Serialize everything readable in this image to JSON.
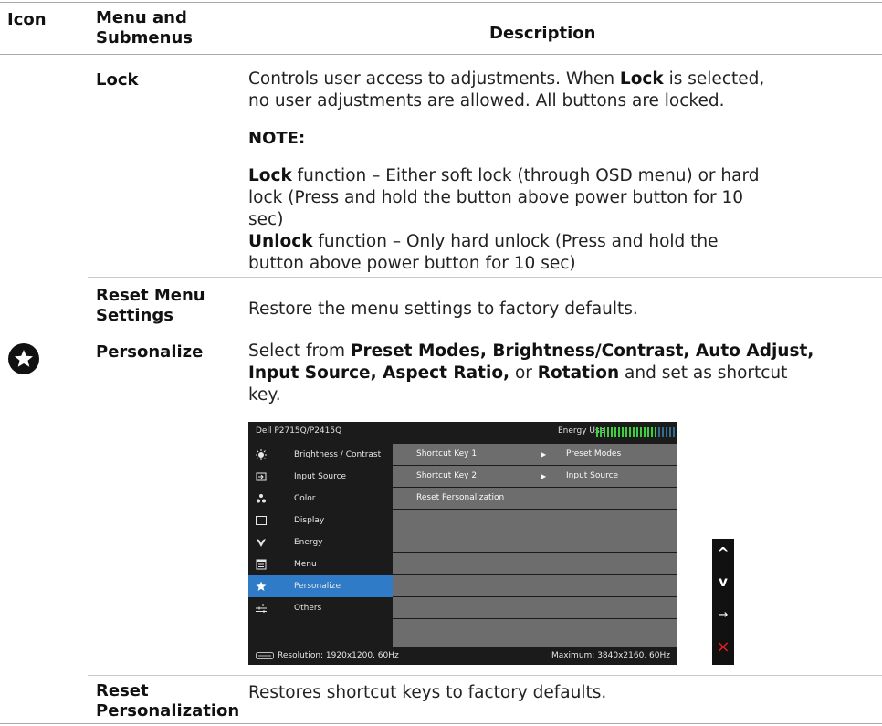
{
  "header": {
    "icon": "Icon",
    "menu_line1": "Menu and",
    "menu_line2": "Submenus",
    "description": "Description"
  },
  "rows": {
    "lock": {
      "label": "Lock",
      "desc_l1_a": "Controls user access to adjustments. When ",
      "desc_l1_b": "Lock",
      "desc_l1_c": " is selected,",
      "desc_l2": "no user adjustments are allowed. All buttons are locked.",
      "note_title": "NOTE:",
      "note1_bold": "Lock",
      "note1_l1": " function – Either soft lock (through OSD menu) or hard",
      "note1_l2": "lock (Press and hold the button above power button for 10",
      "note1_l3": "sec)",
      "note2_bold": "Unlock",
      "note2_l1": " function – Only hard unlock (Press and hold the",
      "note2_l2": "button above power button for 10 sec)"
    },
    "reset_menu": {
      "label_l1": "Reset Menu",
      "label_l2": "Settings",
      "desc": "Restore the menu settings to factory defaults."
    },
    "personalize": {
      "icon": "star-icon",
      "label": "Personalize",
      "d1": "Select from ",
      "b1": "Preset Modes, Brightness/Contrast, Auto Adjust,",
      "b2": "Input Source, Aspect Ratio,",
      "d2": " or ",
      "b3": "Rotation",
      "d3": " and set as shortcut",
      "d4": "key."
    },
    "reset_personalization": {
      "label_l1": "Reset",
      "label_l2": "Personalization",
      "desc": "Restores shortcut keys to factory defaults."
    }
  },
  "osd": {
    "title": "Dell P2715Q/P2415Q",
    "energy_label": "Energy Use",
    "energy_level": 0.75,
    "menu": [
      {
        "label": "Brightness / Contrast",
        "icon": "brightness-icon"
      },
      {
        "label": "Input Source",
        "icon": "input-source-icon"
      },
      {
        "label": "Color",
        "icon": "color-icon"
      },
      {
        "label": "Display",
        "icon": "display-icon"
      },
      {
        "label": "Energy",
        "icon": "energy-icon"
      },
      {
        "label": "Menu",
        "icon": "menu-icon"
      },
      {
        "label": "Personalize",
        "icon": "star-icon",
        "selected": true
      },
      {
        "label": "Others",
        "icon": "others-icon"
      }
    ],
    "options": [
      {
        "key": "Shortcut Key 1",
        "value": "Preset Modes"
      },
      {
        "key": "Shortcut Key 2",
        "value": "Input Source"
      },
      {
        "key": "Reset Personalization",
        "value": ""
      }
    ],
    "resolution": "Resolution: 1920x1200, 60Hz",
    "maximum": "Maximum: 3840x2160, 60Hz"
  },
  "side_buttons": [
    "^",
    "v",
    "→",
    "×"
  ],
  "colors": {
    "accent_selected": "#2f7bc7",
    "energy_green": "#3ecf3e",
    "close_red": "#e02020"
  }
}
